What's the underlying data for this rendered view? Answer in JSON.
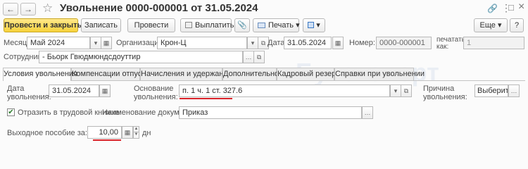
{
  "window": {
    "title": "Увольнение 0000-000001 от 31.05.2024",
    "back_icon": "←",
    "forward_icon": "→",
    "star_icon": "☆",
    "link_icon": "🔗",
    "more_icon": "⋮",
    "maximize_icon": "□",
    "close_icon": "×"
  },
  "toolbar": {
    "post_close": "Провести и закрыть",
    "save": "Записать",
    "post": "Провести",
    "pay": "Выплатить",
    "attach_icon": "📎",
    "print": "Печать",
    "more_arrow": "▾",
    "more": "Еще",
    "help": "?"
  },
  "header": {
    "month_label": "Месяц:",
    "month_value": "Май 2024",
    "org_label": "Организация:",
    "org_value": "Крон-Ц",
    "date_label": "Дата:",
    "date_value": "31.05.2024",
    "number_label": "Номер:",
    "number_value": "0000-000001",
    "print_as_label": "печатать как:",
    "print_as_value": "1",
    "employee_label": "Сотрудник:",
    "employee_value": "- Бьорк Гвюдмюндсдоуттир"
  },
  "tabs": [
    "Условия увольнения",
    "Компенсации отпуска",
    "Начисления и удержания",
    "Дополнительно",
    "Кадровый резерв",
    "Справки при увольнении"
  ],
  "conditions": {
    "dismissal_date_label": "Дата увольнения:",
    "dismissal_date_value": "31.05.2024",
    "basis_label": "Основание увольнения:",
    "basis_value": "п. 1 ч. 1 ст. 327.6",
    "reason_label": "Причина увольнения:",
    "reason_value": "Выберите",
    "record_checkbox_label": "Отразить в трудовой книжке",
    "record_checked": true,
    "doc_name_label": "Наименование документа:",
    "doc_name_value": "Приказ",
    "severance_label": "Выходное пособие за:",
    "severance_value": "10,00",
    "severance_unit": "дн"
  },
  "watermark": "Бухэксперт"
}
